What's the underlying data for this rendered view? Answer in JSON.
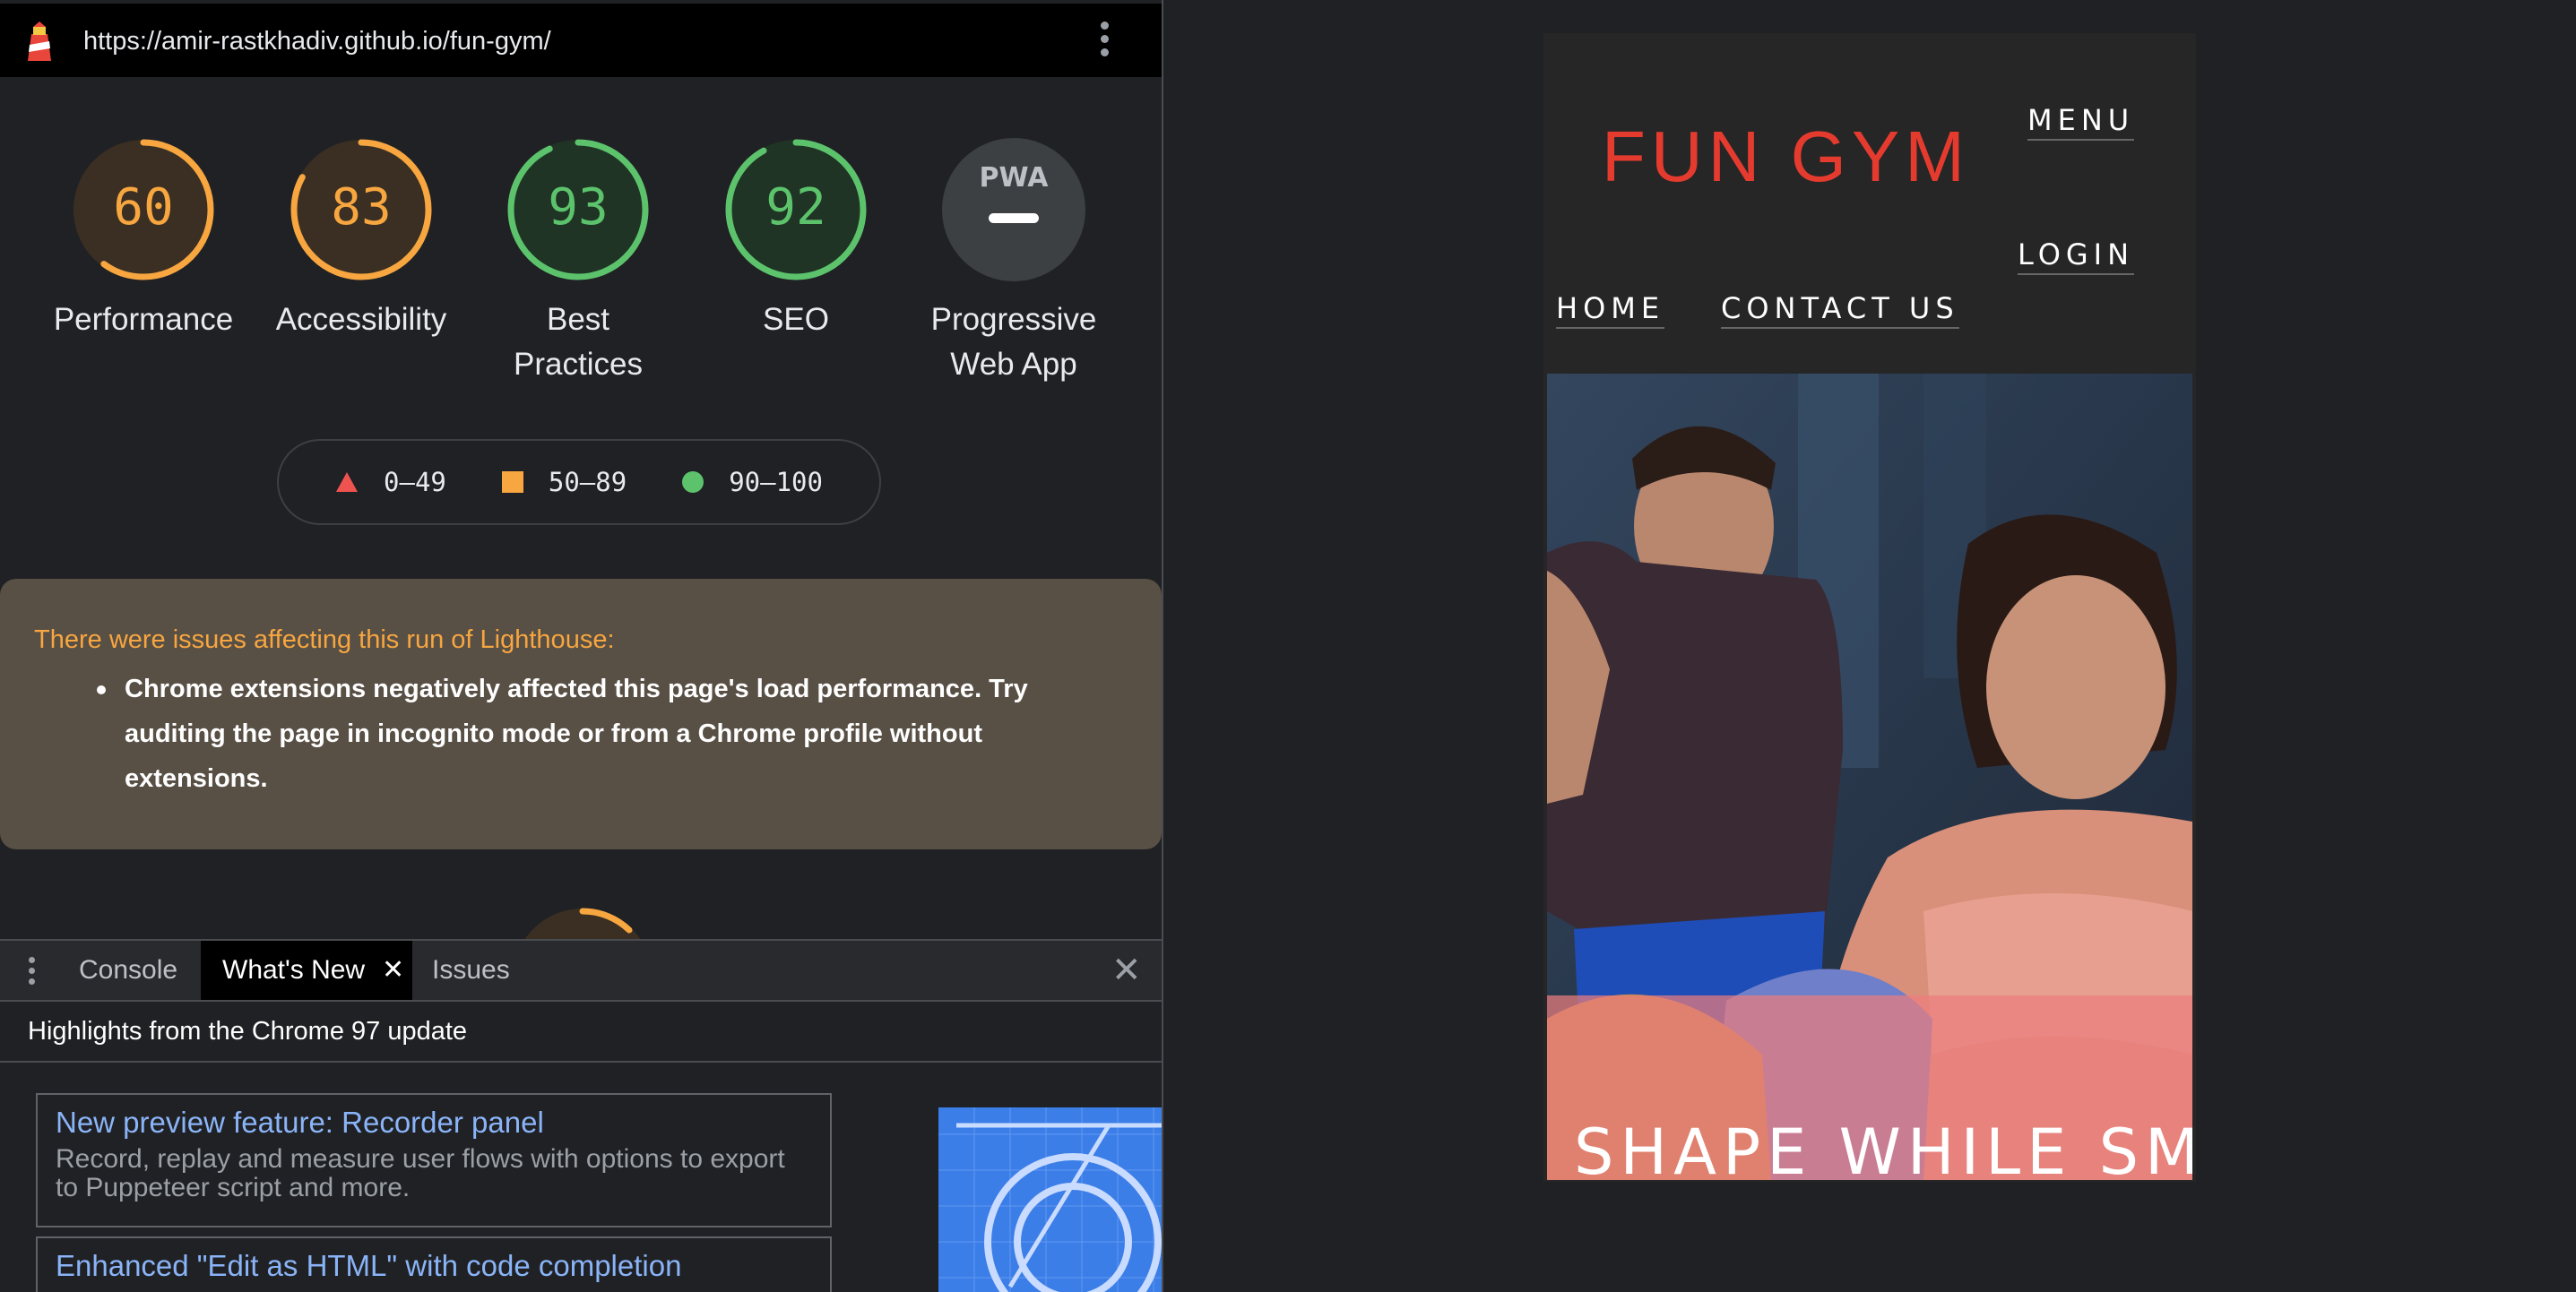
{
  "devtools": {
    "url": "https://amir-rastkhadiv.github.io/fun-gym/",
    "scores": [
      {
        "label": "Performance",
        "value": "60",
        "fraction": 0.6,
        "color": "#f7a640"
      },
      {
        "label": "Accessibility",
        "value": "83",
        "fraction": 0.83,
        "color": "#f7a640"
      },
      {
        "label": "Best Practices",
        "value": "93",
        "fraction": 0.93,
        "color": "#5cc36c"
      },
      {
        "label": "SEO",
        "value": "92",
        "fraction": 0.92,
        "color": "#5cc36c"
      },
      {
        "label": "Progressive Web App",
        "value": "PWA",
        "fraction": 0,
        "color": "#9aa0a6"
      }
    ],
    "legend": [
      {
        "range": "0–49",
        "icon": "triangle-icon",
        "color": "#ef5350"
      },
      {
        "range": "50–89",
        "icon": "square-icon",
        "color": "#f7a640"
      },
      {
        "range": "90–100",
        "icon": "circle-icon",
        "color": "#5cc36c"
      }
    ],
    "warning": {
      "title": "There were issues affecting this run of Lighthouse:",
      "item": "Chrome extensions negatively affected this page's load performance. Try auditing the page in incognito mode or from a Chrome profile without extensions."
    },
    "drawer": {
      "tabs": [
        "Console",
        "What's New",
        "Issues"
      ],
      "active_tab": "What's New",
      "heading": "Highlights from the Chrome 97 update",
      "cards": [
        {
          "title": "New preview feature: Recorder panel",
          "description": "Record, replay and measure user flows with options to export to Puppeteer script and more."
        },
        {
          "title": "Enhanced \"Edit as HTML\" with code completion",
          "description": ""
        }
      ]
    }
  },
  "site": {
    "logo": "FUN GYM",
    "nav": {
      "menu": "MENU",
      "login": "LOGIN",
      "home": "HOME",
      "contact": "CONTACT US"
    },
    "hero_tagline": "SHAPE WHILE SMI"
  }
}
